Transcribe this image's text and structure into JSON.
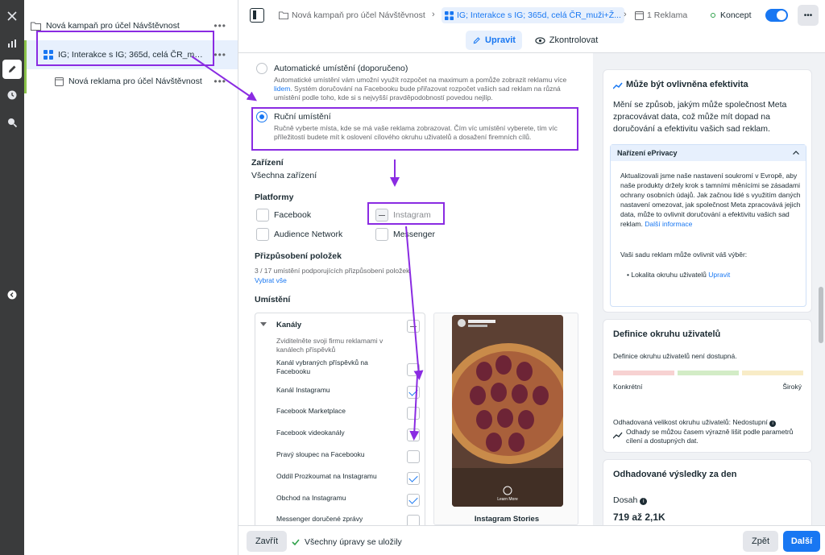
{
  "tree": {
    "campaign_label": "Nová kampaň pro účel Návštěvnost",
    "adset_label": "IG; Interakce s IG; 365d, celá ČR_muži+...",
    "ad_label": "Nová reklama pro účel Návštěvnost",
    "more": "•••"
  },
  "topbar": {
    "crumb_campaign": "Nová kampaň pro účel Návštěvnost",
    "crumb_adset": "IG; Interakce s IG; 365d, celá ČR_muži+Ž...",
    "crumb_ads": "1 Reklama",
    "status": "Koncept",
    "more": "•••",
    "tab_edit": "Upravit",
    "tab_review": "Zkontrolovat"
  },
  "placement": {
    "auto_title": "Automatické umístění (doporučeno)",
    "auto_desc_1": "Automatické umístění vám umožní využít rozpočet na maximum a pomůže zobrazit reklamu více",
    "auto_desc_link": "lidem",
    "auto_desc_2": ". Systém doručování na Facebooku bude přiřazovat rozpočet vašich sad reklam na různá",
    "auto_desc_3": "umístění podle toho, kde si s nejvyšší pravděpodobností povedou nejlíp.",
    "manual_title": "Ruční umístění",
    "manual_desc_1": "Ručně vyberte místa, kde se má vaše reklama zobrazovat. Čím víc umístění vyberete, tím víc",
    "manual_desc_2": "příležitostí budete mít k oslovení cílového okruhu uživatelů a dosažení firemních cílů.",
    "devices_title": "Zařízení",
    "devices_value": "Všechna zařízení",
    "platforms_title": "Platformy",
    "platform_facebook": "Facebook",
    "platform_instagram": "Instagram",
    "platform_audience_network": "Audience Network",
    "platform_messenger": "Messenger",
    "customization_title": "Přizpůsobení položek",
    "customization_desc": "3 / 17 umístění podporujících přizpůsobení položek",
    "select_all": "Vybrat vše",
    "placements_title": "Umístění",
    "feeds_title": "Kanály",
    "feeds_desc_1": "Zviditelněte svoji firmu reklamami v",
    "feeds_desc_2": "kanálech příspěvků",
    "items": [
      {
        "label": "Kanál vybraných příspěvků na",
        "label2": "Facebooku",
        "checked": false
      },
      {
        "label": "Kanál Instagramu",
        "label2": "",
        "checked": true
      },
      {
        "label": "Facebook Marketplace",
        "label2": "",
        "checked": false
      },
      {
        "label": "Facebook videokanály",
        "label2": "",
        "checked": false
      },
      {
        "label": "Pravý sloupec na Facebooku",
        "label2": "",
        "checked": false
      },
      {
        "label": "Oddíl Prozkoumat na Instagramu",
        "label2": "",
        "checked": true
      },
      {
        "label": "Obchod na Instagramu",
        "label2": "",
        "checked": true
      },
      {
        "label": "Messenger doručené zprávy",
        "label2": "",
        "checked": false
      }
    ],
    "preview_caption": "Instagram Stories",
    "preview_learn_more": "Learn More"
  },
  "right": {
    "effect_title": "Může být ovlivněna efektivita",
    "effect_body": "Mění se způsob, jakým může společnost Meta zpracovávat data, což může mít dopad na doručování a efektivitu vašich sad reklam.",
    "eprivacy_title": "Nařízení ePrivacy",
    "eprivacy_body": "Aktualizovali jsme naše nastavení soukromí v Evropě, aby naše produkty držely krok s tamními měnícími se zásadami ochrany osobních údajů. Jak začnou lidé s využitím daných nastavení omezovat, jak společnost Meta zpracovává jejich data, může to ovlivnit doručování a efektivitu vašich sad reklam.",
    "eprivacy_link": "Další informace",
    "eprivacy_affect": "Vaši sadu reklam může ovlivnit váš výběr:",
    "eprivacy_bullet": "Lokalita okruhu uživatelů",
    "eprivacy_edit": "Upravit",
    "audience_title": "Definice okruhu uživatelů",
    "audience_unavailable": "Definice okruhu uživatelů není dostupná.",
    "specific": "Konkrétní",
    "broad": "Široký",
    "est_size": "Odhadovaná velikost okruhu uživatelů: Nedostupní",
    "est_note": "Odhady se můžou časem výrazně lišit podle parametrů cílení a dostupných dat.",
    "results_title": "Odhadované výsledky za den",
    "reach_label": "Dosah",
    "reach_value": "719 až 2,1K"
  },
  "bottom": {
    "close": "Zavřít",
    "saved": "Všechny úpravy se uložily",
    "back": "Zpět",
    "next": "Další"
  },
  "colors": {
    "accent": "#1877f2",
    "annotation": "#8a2be2",
    "status_green": "#31a24c"
  }
}
